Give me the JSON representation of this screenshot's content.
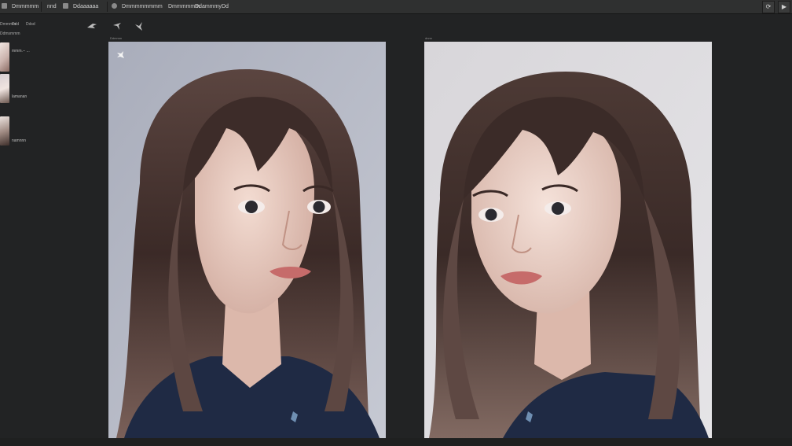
{
  "window": {
    "tabs": [
      "Dmmmmm",
      "nnd",
      "Ddaaaaaa",
      "Dmmmmmmmm",
      "Dmmmmmm",
      "Ddammmy",
      "Dd"
    ],
    "right_buttons": [
      {
        "icon": "refresh-icon",
        "glyph": "⟳"
      },
      {
        "icon": "play-icon",
        "glyph": "▶"
      }
    ]
  },
  "toolbar": {
    "row1": [
      "Dmmmm",
      "Ddd",
      "Ddsd"
    ],
    "row2": "Ddmsmmm",
    "tools": [
      "paint-brush-icon",
      "cursor-arrow-icon",
      "pen-tool-icon"
    ]
  },
  "sidebar": {
    "items": [
      {
        "label": "mmm.-- ..."
      },
      {
        "label": "lamanan"
      },
      {
        "label": "namnnn"
      }
    ]
  },
  "panels": {
    "left_label": "Ddmmm",
    "right_label": "dnnn",
    "left_overlay_icon": "pin-icon"
  },
  "colors": {
    "app_bg": "#222324",
    "topbar_bg": "#2f3030",
    "left_canvas_bg": "#a9adbb",
    "right_canvas_bg": "#dcdbdd",
    "hair": "#4a3a36",
    "shirt": "#1f2a44"
  }
}
